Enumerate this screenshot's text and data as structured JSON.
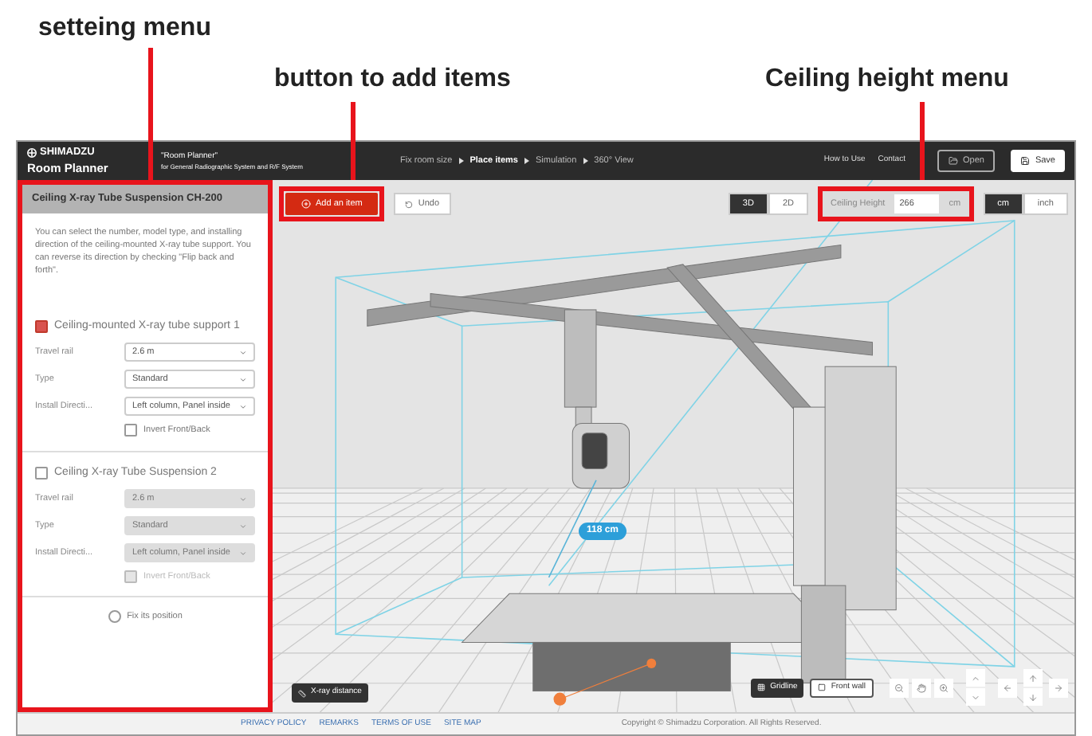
{
  "annotations": [
    {
      "label": "setteing menu"
    },
    {
      "label": "button to add items"
    },
    {
      "label": "Ceiling height menu"
    }
  ],
  "header": {
    "brand": "SHIMADZU",
    "app_name": "Room Planner",
    "project_title": "\"Room Planner\"",
    "project_subtitle": "for General Radiographic System and R/F System",
    "steps": [
      {
        "label": "Fix room size",
        "selected": false
      },
      {
        "label": "Place items",
        "selected": true
      },
      {
        "label": "Simulation",
        "selected": false
      },
      {
        "label": "360° View",
        "selected": false
      }
    ],
    "links": [
      "How to Use",
      "Contact"
    ],
    "buttons": [
      {
        "label": "Open",
        "kind": "open"
      },
      {
        "label": "Save",
        "kind": "save"
      }
    ]
  },
  "sidebar": {
    "title": "Ceiling X-ray Tube Suspension CH-200",
    "description": "You can select the number, model type, and installing direction of the ceiling-mounted X-ray tube support. You can reverse its direction by checking \"Flip back and forth\".",
    "groups": [
      {
        "title": "Ceiling-mounted X-ray tube support 1",
        "checked": true,
        "fields": [
          {
            "label": "Travel rail",
            "value": "2.6 m"
          },
          {
            "label": "Type",
            "value": "Standard"
          },
          {
            "label": "Install Directi...",
            "value": "Left column, Panel inside"
          }
        ],
        "invert": {
          "label": "Invert Front/Back",
          "checked": false
        }
      },
      {
        "title": "Ceiling X-ray Tube Suspension 2",
        "checked": false,
        "fields": [
          {
            "label": "Travel rail",
            "value": "2.6 m"
          },
          {
            "label": "Type",
            "value": "Standard"
          },
          {
            "label": "Install Directi...",
            "value": "Left column, Panel inside"
          }
        ],
        "invert": {
          "label": "Invert Front/Back",
          "checked": false
        }
      }
    ],
    "fix": {
      "label": "Fix its position",
      "checked": false
    }
  },
  "toolbar": {
    "add_button": "Add an item",
    "undo": "Undo",
    "view_toggle": [
      {
        "label": "3D",
        "selected": true
      },
      {
        "label": "2D",
        "selected": false
      }
    ],
    "ceiling": {
      "label": "Ceiling Height",
      "value": "266",
      "unit": "cm"
    },
    "unit_toggle": [
      {
        "label": "cm",
        "selected": true
      },
      {
        "label": "inch",
        "selected": false
      }
    ]
  },
  "scene": {
    "distance_label": "118 cm",
    "xray_distance": "X-ray distance",
    "gridline": "Gridline",
    "front_wall": "Front wall"
  },
  "footer": {
    "links": [
      "PRIVACY POLICY",
      "REMARKS",
      "TERMS OF USE",
      "SITE MAP"
    ],
    "copyright": "Copyright © Shimadzu Corporation. All Rights Reserved."
  }
}
